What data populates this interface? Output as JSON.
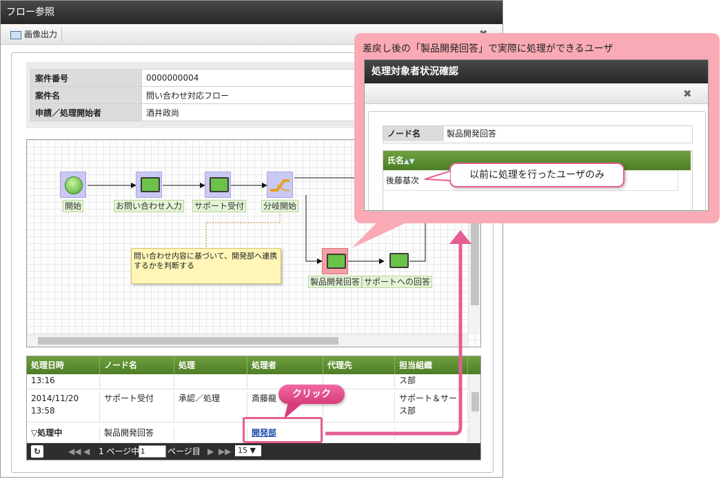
{
  "window": {
    "title": "フロー参照",
    "toolbar_export_label": "画像出力"
  },
  "info": {
    "rows": [
      {
        "label": "案件番号",
        "value": "0000000004"
      },
      {
        "label": "案件名",
        "value": "問い合わせ対応フロー"
      },
      {
        "label": "申請／処理開始者",
        "value": "酒井政尚"
      }
    ]
  },
  "diagram": {
    "nodes": [
      "開始",
      "お問い合わせ入力",
      "サポート受付",
      "分岐開始",
      "製品開発回答",
      "サポートへの回答"
    ],
    "note": "問い合わせ内容に基づいて、開発部へ連携するかを判断する"
  },
  "history": {
    "headers": [
      "処理日時",
      "ノード名",
      "処理",
      "処理者",
      "代理先",
      "担当組織"
    ],
    "rows": [
      {
        "date": "13:16",
        "date2": "",
        "node": "",
        "action": "",
        "user": "",
        "proxy": "",
        "org": "ス部",
        "org2": ""
      },
      {
        "date": "2014/11/20",
        "date2": "13:58",
        "node": "サポート受付",
        "action": "承認／処理",
        "user": "斎藤龍",
        "proxy": "",
        "org": "サポート＆サー",
        "org2": "ス部"
      },
      {
        "date": "▽処理中",
        "date2": "",
        "node": "製品開発回答",
        "action": "",
        "user": "開発部",
        "proxy": "",
        "org": "",
        "org2": ""
      }
    ],
    "pager": {
      "page_label": "1 ページ中",
      "page_value": "1",
      "page_suffix": "ページ目",
      "page_size": "15"
    }
  },
  "overlay": {
    "caption": "差戻し後の「製品開発回答」で実際に処理ができるユーザ",
    "title": "処理対象者状況確認",
    "node_label": "ノード名",
    "node_value": "製品開発回答",
    "name_header": "氏名",
    "name_row": "後藤基次",
    "callout_text": "以前に処理を行ったユーザのみ",
    "click_label": "クリック"
  },
  "colors": {
    "accent_green": "#5a8a2e",
    "pink": "#f9aab5",
    "callout_border": "#e45d93"
  }
}
